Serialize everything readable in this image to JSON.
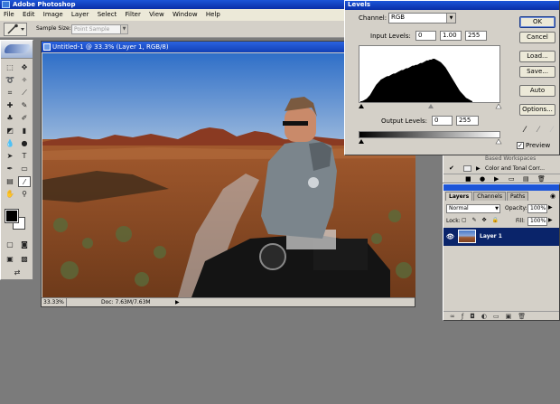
{
  "app": {
    "title": "Adobe Photoshop"
  },
  "menu": [
    "File",
    "Edit",
    "Image",
    "Layer",
    "Select",
    "Filter",
    "View",
    "Window",
    "Help"
  ],
  "options_bar": {
    "sample_size_label": "Sample Size:",
    "sample_size_value": "Point Sample"
  },
  "document": {
    "title": "Untitled-1 @ 33.3% (Layer 1, RGB/8)",
    "zoom": "33.33%",
    "doc_info": "Doc: 7.63M/7.63M",
    "window_buttons": [
      "_",
      "□",
      "×"
    ]
  },
  "levels": {
    "title": "Levels",
    "channel_label": "Channel:",
    "channel_value": "RGB",
    "input_levels_label": "Input Levels:",
    "input_black": "0",
    "input_gamma": "1.00",
    "input_white": "255",
    "output_levels_label": "Output Levels:",
    "output_black": "0",
    "output_white": "255",
    "buttons": {
      "ok": "OK",
      "cancel": "Cancel",
      "load": "Load...",
      "save": "Save...",
      "auto": "Auto",
      "options": "Options..."
    },
    "preview_label": "Preview",
    "preview_checked": true,
    "histogram": [
      1,
      1,
      2,
      3,
      4,
      6,
      8,
      11,
      14,
      17,
      20,
      22,
      24,
      26,
      27,
      28,
      29,
      30,
      30,
      31,
      32,
      33,
      33,
      34,
      35,
      36,
      37,
      37,
      38,
      39,
      39,
      40,
      41,
      42,
      42,
      43,
      43,
      44,
      45,
      45,
      46,
      47,
      48,
      48,
      49,
      49,
      50,
      50,
      49,
      48,
      47,
      46,
      44,
      42,
      40,
      37,
      34,
      31,
      28,
      25,
      22,
      19,
      16,
      13,
      11,
      9,
      7,
      5,
      4,
      3,
      2,
      1
    ]
  },
  "history": {
    "items": [
      "Color and Tonal Corr..."
    ],
    "partial_item": "Based Workspaces"
  },
  "layers_panel": {
    "tabs": [
      "Layers",
      "Channels",
      "Paths"
    ],
    "blend_mode": "Normal",
    "opacity_label": "Opacity:",
    "opacity_value": "100%",
    "lock_label": "Lock:",
    "fill_label": "Fill:",
    "fill_value": "100%",
    "layer_name": "Layer 1",
    "footer_icons": [
      "link-icon",
      "style-icon",
      "mask-icon",
      "fill-layer-icon",
      "group-icon",
      "new-layer-icon",
      "trash-icon"
    ]
  },
  "toolbox": {
    "tools": [
      "marquee",
      "move",
      "lasso",
      "magic-wand",
      "crop",
      "slice",
      "healing",
      "brush",
      "stamp",
      "history-brush",
      "eraser",
      "gradient",
      "blur",
      "dodge",
      "path-select",
      "type",
      "pen",
      "shape",
      "notes",
      "eyedropper",
      "hand",
      "zoom"
    ],
    "foreground": "#000000",
    "background": "#ffffff"
  }
}
